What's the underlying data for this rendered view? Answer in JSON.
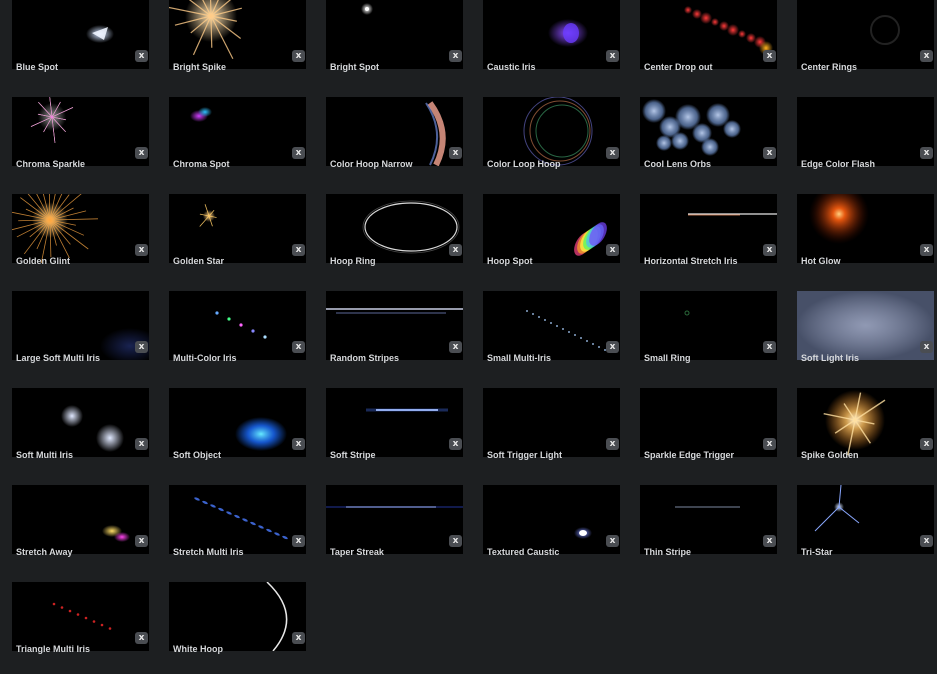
{
  "close_label": "x",
  "presets": [
    {
      "name": "Blue Spot",
      "fx": "blue-spot"
    },
    {
      "name": "Bright Spike",
      "fx": "bright-spike"
    },
    {
      "name": "Bright Spot",
      "fx": "bright-spot"
    },
    {
      "name": "Caustic Iris",
      "fx": "caustic-iris"
    },
    {
      "name": "Center Drop out",
      "fx": "center-drop-out"
    },
    {
      "name": "Center Rings",
      "fx": "center-rings"
    },
    {
      "name": "Chroma Sparkle",
      "fx": "chroma-sparkle"
    },
    {
      "name": "Chroma Spot",
      "fx": "chroma-spot"
    },
    {
      "name": "Color Hoop Narrow",
      "fx": "color-hoop-narrow"
    },
    {
      "name": "Color Loop Hoop",
      "fx": "color-loop-hoop"
    },
    {
      "name": "Cool Lens Orbs",
      "fx": "cool-lens-orbs"
    },
    {
      "name": "Edge Color Flash",
      "fx": "edge-color-flash"
    },
    {
      "name": "Golden Glint",
      "fx": "golden-glint"
    },
    {
      "name": "Golden Star",
      "fx": "golden-star"
    },
    {
      "name": "Hoop Ring",
      "fx": "hoop-ring"
    },
    {
      "name": "Hoop Spot",
      "fx": "hoop-spot"
    },
    {
      "name": "Horizontal Stretch Iris",
      "fx": "horizontal-stretch-iris"
    },
    {
      "name": "Hot Glow",
      "fx": "hot-glow"
    },
    {
      "name": "Large Soft Multi Iris",
      "fx": "large-soft-multi-iris"
    },
    {
      "name": "Multi-Color Iris",
      "fx": "multi-color-iris"
    },
    {
      "name": "Random Stripes",
      "fx": "random-stripes"
    },
    {
      "name": "Small Multi-Iris",
      "fx": "small-multi-iris"
    },
    {
      "name": "Small Ring",
      "fx": "small-ring"
    },
    {
      "name": "Soft Light Iris",
      "fx": "soft-light-iris"
    },
    {
      "name": "Soft Multi Iris",
      "fx": "soft-multi-iris"
    },
    {
      "name": "Soft Object",
      "fx": "soft-object"
    },
    {
      "name": "Soft Stripe",
      "fx": "soft-stripe"
    },
    {
      "name": "Soft Trigger Light",
      "fx": "soft-trigger-light"
    },
    {
      "name": "Sparkle Edge Trigger",
      "fx": "sparkle-edge-trigger"
    },
    {
      "name": "Spike Golden",
      "fx": "spike-golden"
    },
    {
      "name": "Stretch Away",
      "fx": "stretch-away"
    },
    {
      "name": "Stretch Multi Iris",
      "fx": "stretch-multi-iris"
    },
    {
      "name": "Taper Streak",
      "fx": "taper-streak"
    },
    {
      "name": "Textured Caustic",
      "fx": "textured-caustic"
    },
    {
      "name": "Thin Stripe",
      "fx": "thin-stripe"
    },
    {
      "name": "Tri-Star",
      "fx": "tri-star"
    },
    {
      "name": "Triangle Multi Iris",
      "fx": "triangle-multi-iris"
    },
    {
      "name": "White Hoop",
      "fx": "white-hoop"
    }
  ]
}
